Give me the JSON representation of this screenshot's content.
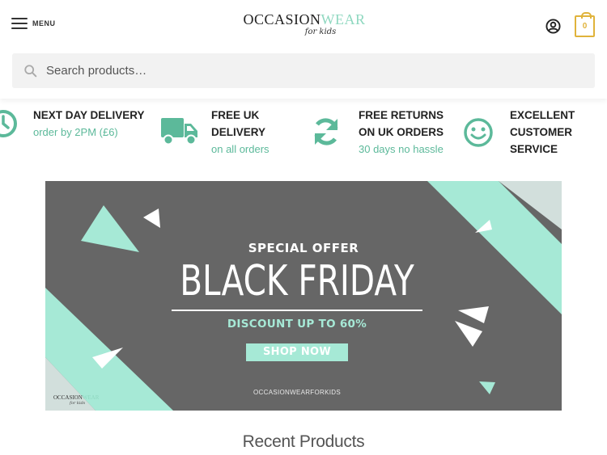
{
  "header": {
    "menu_label": "MENU",
    "logo": {
      "part1": "OCCASION",
      "part2": "WEAR",
      "tagline": "for kids"
    },
    "cart_count": "0"
  },
  "search": {
    "placeholder": "Search products…"
  },
  "usps": [
    {
      "icon": "clock-icon",
      "title_lines": [
        "NEXT DAY DELIVERY"
      ],
      "subtitle": "order by 2PM (£6)"
    },
    {
      "icon": "delivery-truck-icon",
      "title_lines": [
        "FREE UK",
        "DELIVERY"
      ],
      "subtitle": "on all orders"
    },
    {
      "icon": "returns-sync-icon",
      "title_lines": [
        "FREE RETURNS",
        "ON UK ORDERS"
      ],
      "subtitle": "30 days no hassle"
    },
    {
      "icon": "smiley-icon",
      "title_lines": [
        "EXCELLENT",
        "CUSTOMER",
        "SERVICE"
      ],
      "subtitle": ""
    }
  ],
  "banner": {
    "offer": "SPECIAL OFFER",
    "title": "BLACK FRIDAY",
    "discount": "DISCOUNT UP TO 60%",
    "cta": "SHOP NOW",
    "site": "OCCASIONWEARFORKIDS",
    "logo_part1": "OCCASION",
    "logo_part2": "WEAR",
    "logo_tagline": "for kids"
  },
  "section": {
    "title": "Recent Products"
  },
  "colors": {
    "accent_mint": "#a6e9d6",
    "accent_green_text": "#5cb99a",
    "banner_gray": "#666666",
    "cart_gold": "#e0b33b"
  }
}
